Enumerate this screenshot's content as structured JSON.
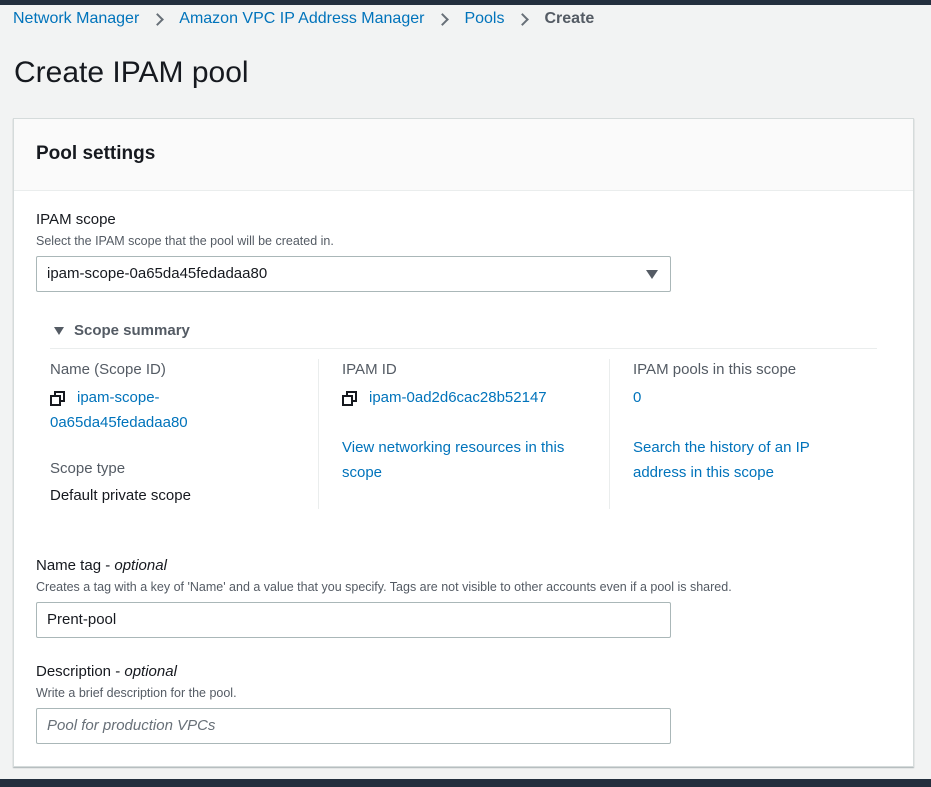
{
  "breadcrumb": {
    "items": [
      "Network Manager",
      "Amazon VPC IP Address Manager",
      "Pools"
    ],
    "current": "Create"
  },
  "page": {
    "title": "Create IPAM pool"
  },
  "pool_settings": {
    "title": "Pool settings",
    "ipam_scope": {
      "label": "IPAM scope",
      "description": "Select the IPAM scope that the pool will be created in.",
      "selected_value": "ipam-scope-0a65da45fedadaa80"
    },
    "scope_summary": {
      "title": "Scope summary",
      "name_label": "Name (Scope ID)",
      "name_value_line1": "ipam-scope-",
      "name_value_line2": "0a65da45fedadaa80",
      "scope_type_label": "Scope type",
      "scope_type_value": "Default private scope",
      "ipam_id_label": "IPAM ID",
      "ipam_id_value": "ipam-0ad2d6cac28b52147",
      "view_resources_line1": "View networking resources in this",
      "view_resources_line2": "scope",
      "pools_label": "IPAM pools in this scope",
      "pools_value": "0",
      "history_line1": "Search the history of an IP",
      "history_line2": "address in this scope"
    },
    "name_tag": {
      "label": "Name tag - ",
      "label_optional": "optional",
      "description": "Creates a tag with a key of 'Name' and a value that you specify. Tags are not visible to other accounts even if a pool is shared.",
      "value": "Prent-pool"
    },
    "description_field": {
      "label": "Description - ",
      "label_optional": "optional",
      "description": "Write a brief description for the pool.",
      "placeholder": "Pool for production VPCs"
    }
  },
  "icons": {
    "copy": "copy-icon",
    "expand": "caret-down-icon",
    "select": "dropdown-caret-icon",
    "separator": "chevron-right-icon"
  },
  "colors": {
    "link": "#0073bb",
    "nav_bar": "#232f3e",
    "background": "#f2f3f3"
  }
}
